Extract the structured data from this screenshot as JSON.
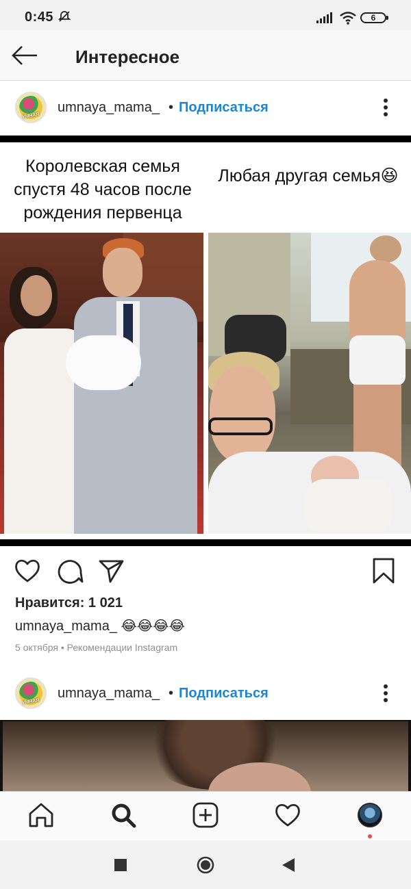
{
  "status_bar": {
    "time": "0:45",
    "battery": "6"
  },
  "header": {
    "title": "Интересное"
  },
  "posts": [
    {
      "username": "umnaya_mama_",
      "separator": "•",
      "follow_label": "Подписаться",
      "avatar_text": "УМНАЯ",
      "meme": {
        "caption_left": "Королевская семья спустя 48 часов после рождения первенца",
        "caption_right": "Любая другая семья😆"
      },
      "likes": "Нравится: 1 021",
      "caption": "umnaya_mama_ 😂😂😂😂",
      "meta": "5 октября • Рекомендации Instagram"
    },
    {
      "username": "umnaya_mama_",
      "separator": "•",
      "follow_label": "Подписаться",
      "avatar_text": "УМНАЯ"
    }
  ],
  "icons": {
    "back": "arrow-left",
    "like": "heart-outline",
    "comment": "speech-bubble",
    "share": "paper-plane",
    "save": "bookmark",
    "home": "home",
    "search": "magnifier",
    "add": "plus-square",
    "activity": "heart-outline",
    "more": "vertical-dots"
  },
  "colors": {
    "follow": "#1a86d8",
    "notification_dot": "#ed4956",
    "meta": "#8e8e8e"
  }
}
